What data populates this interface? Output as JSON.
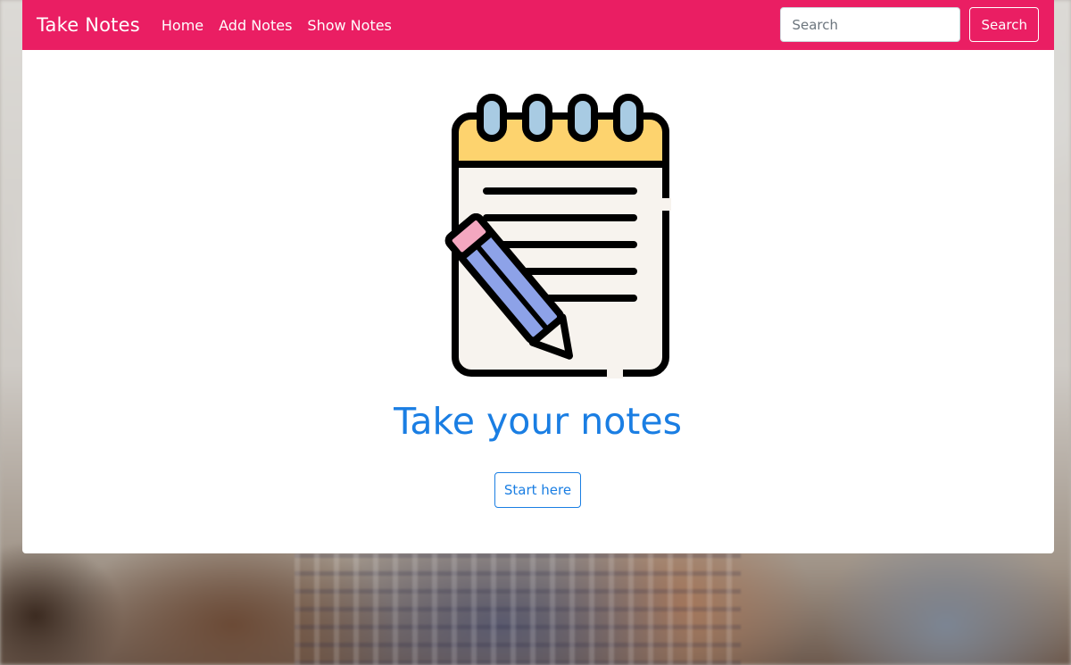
{
  "navbar": {
    "brand": "Take Notes",
    "links": [
      "Home",
      "Add Notes",
      "Show Notes"
    ],
    "search_placeholder": "Search",
    "search_button": "Search",
    "color": "#ea1e63"
  },
  "hero": {
    "illustration": "notepad-pencil-icon",
    "title": "Take your notes",
    "button_label": "Start here",
    "accent_color": "#1a7ee3"
  }
}
